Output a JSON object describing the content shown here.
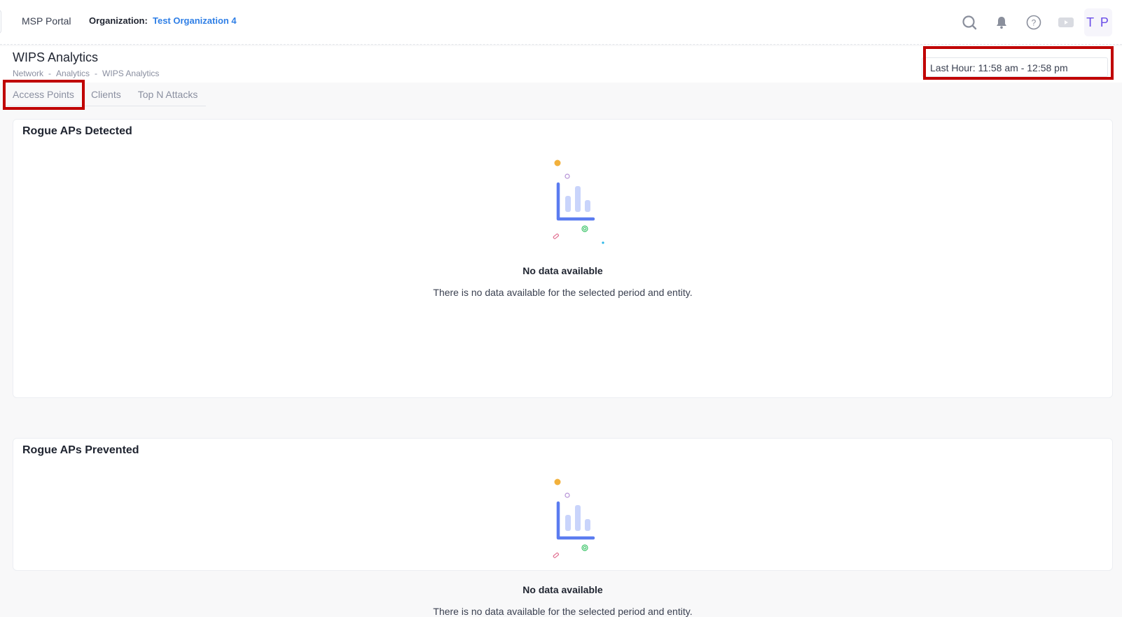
{
  "topbar": {
    "portal_name": "MSP Portal",
    "org_label": "Organization:",
    "org_value": "Test Organization 4",
    "icons": [
      "search-icon",
      "bell-icon",
      "help-icon",
      "video-icon"
    ],
    "avatar_initials": "T P"
  },
  "header": {
    "title": "WIPS Analytics",
    "breadcrumb": [
      "Network",
      "Analytics",
      "WIPS Analytics"
    ],
    "breadcrumb_separator": "-",
    "time_range": "Last Hour: 11:58 am - 12:58 pm"
  },
  "tabs": [
    {
      "label": "Access Points"
    },
    {
      "label": "Clients"
    },
    {
      "label": "Top N Attacks"
    }
  ],
  "cards": [
    {
      "title": "Rogue APs Detected",
      "empty_title": "No data available",
      "empty_desc": "There is no data available for the selected period and entity."
    },
    {
      "title": "Rogue APs Prevented",
      "empty_title": "No data available",
      "empty_desc": "There is no data available for the selected period and entity."
    }
  ],
  "colors": {
    "accent_blue": "#2f7fe6",
    "avatar_purple": "#6a4de8",
    "highlight_red": "#c00000",
    "chart_blue": "#5b7cf0",
    "chart_light": "#c9d4fb"
  }
}
